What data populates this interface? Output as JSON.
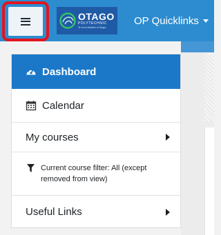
{
  "navbar": {
    "logo": {
      "main": "OTAGO",
      "sub": "POLYTECHNIC",
      "tagline": "Te Kura Matatini ki Otago"
    },
    "quicklinks_label": "OP Quicklinks"
  },
  "drawer": {
    "items": [
      {
        "label": "Dashboard",
        "icon": "dashboard-gauge-icon",
        "active": true
      },
      {
        "label": "Calendar",
        "icon": "calendar-icon"
      },
      {
        "label": "My courses",
        "icon": "chevron-right-icon"
      },
      {
        "label": "Current course filter: All (except removed from view)",
        "icon": "filter-icon"
      },
      {
        "label": "Useful Links",
        "icon": "chevron-right-icon"
      }
    ]
  },
  "colors": {
    "navbar": "#2d8ccf",
    "active_item": "#1b78c8",
    "highlight_ring": "#e3141e",
    "logo_bg": "#1f5aa6"
  }
}
